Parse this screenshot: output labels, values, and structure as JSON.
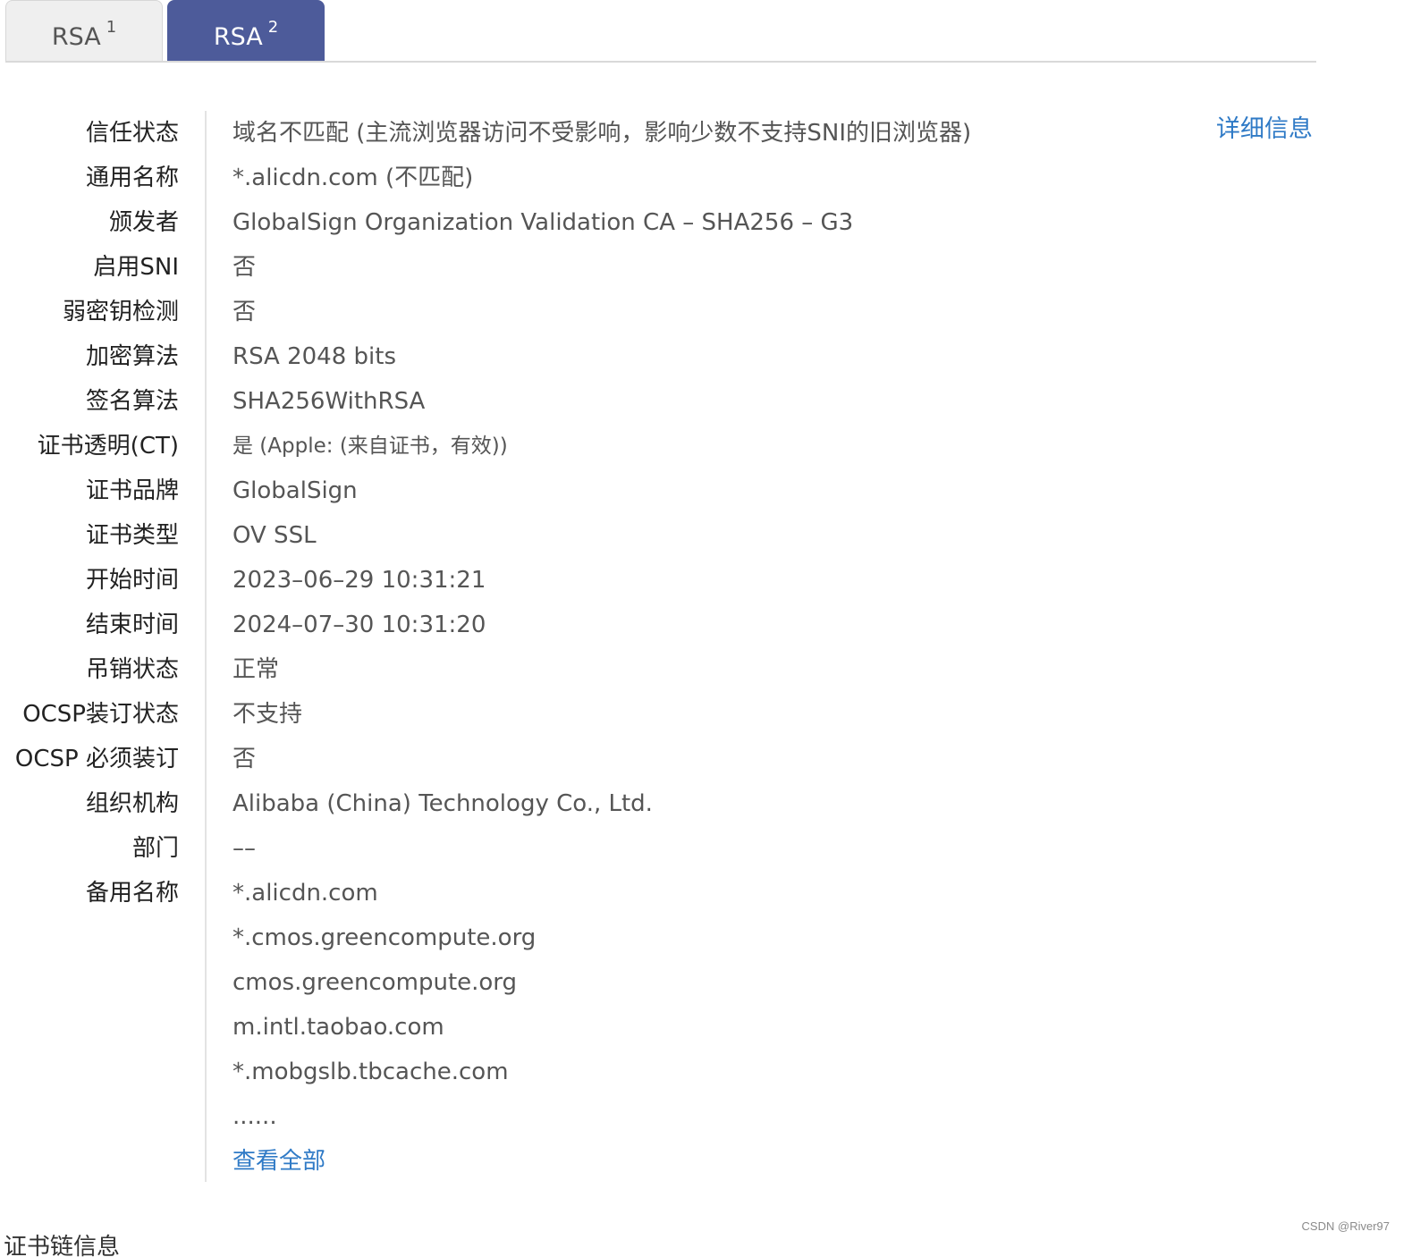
{
  "tabs": [
    {
      "label": "RSA",
      "sup": "1"
    },
    {
      "label": "RSA",
      "sup": "2"
    }
  ],
  "detail_link": "详细信息",
  "rows": [
    {
      "label": "信任状态",
      "value": "域名不匹配 (主流浏览器访问不受影响，影响少数不支持SNI的旧浏览器)"
    },
    {
      "label": "通用名称",
      "value": "*.alicdn.com (不匹配)"
    },
    {
      "label": "颁发者",
      "value": "GlobalSign Organization Validation CA – SHA256 – G3"
    },
    {
      "label": "启用SNI",
      "value": "否"
    },
    {
      "label": "弱密钥检测",
      "value": "否"
    },
    {
      "label": "加密算法",
      "value": "RSA 2048 bits"
    },
    {
      "label": "签名算法",
      "value": "SHA256WithRSA"
    },
    {
      "label": "证书透明(CT)",
      "value": "是  (Apple: (来自证书，有效))"
    },
    {
      "label": "证书品牌",
      "value": "GlobalSign"
    },
    {
      "label": "证书类型",
      "value": "OV SSL"
    },
    {
      "label": "开始时间",
      "value": "2023–06–29 10:31:21"
    },
    {
      "label": "结束时间",
      "value": "2024–07–30 10:31:20"
    },
    {
      "label": "吊销状态",
      "value": "正常"
    },
    {
      "label": "OCSP装订状态",
      "value": "不支持"
    },
    {
      "label": "OCSP 必须装订",
      "value": "否"
    },
    {
      "label": "组织机构",
      "value": "Alibaba (China) Technology Co., Ltd."
    },
    {
      "label": "部门",
      "value": "––"
    },
    {
      "label": "备用名称",
      "value": "*.alicdn.com"
    }
  ],
  "alt_names_more": [
    "*.cmos.greencompute.org",
    "cmos.greencompute.org",
    "m.intl.taobao.com",
    "*.mobgslb.tbcache.com",
    "......"
  ],
  "view_all": "查看全部",
  "bottom_cut_text": "证书链信息",
  "watermark": "CSDN @River97"
}
